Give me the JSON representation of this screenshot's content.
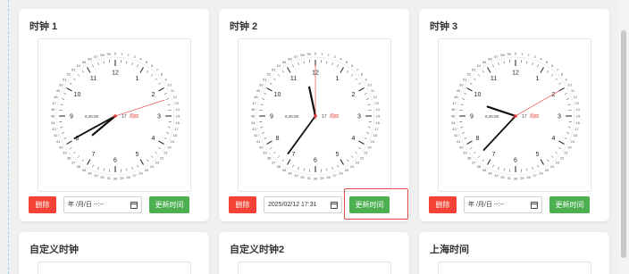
{
  "cards": [
    {
      "title": "时钟 1",
      "datetime": "年 /月/日 --:--",
      "delete_label": "删除",
      "update_label": "更新时间",
      "time": {
        "h": 7,
        "m": 40,
        "s": 12
      },
      "time_text": "8:25:08",
      "day": "17",
      "weekday": "周四"
    },
    {
      "title": "时钟 2",
      "datetime": "2025/02/12 17:31",
      "delete_label": "删除",
      "update_label": "更新时间",
      "time": {
        "h": 11,
        "m": 36,
        "s": 0
      },
      "time_text": "8:25:08",
      "day": "17",
      "weekday": "周四"
    },
    {
      "title": "时钟 3",
      "datetime": "年 /月/日 --:--",
      "delete_label": "删除",
      "update_label": "更新时间",
      "time": {
        "h": 9,
        "m": 37,
        "s": 10
      },
      "time_text": "8:25:08",
      "day": "17",
      "weekday": "周四"
    }
  ],
  "bottom_cards": [
    {
      "title": "自定义时钟"
    },
    {
      "title": "自定义时钟2"
    },
    {
      "title": "上海时间"
    }
  ],
  "colors": {
    "delete": "#f44336",
    "update": "#4caf50",
    "second_hand": "#e53935",
    "highlight": "#e04b4b"
  }
}
